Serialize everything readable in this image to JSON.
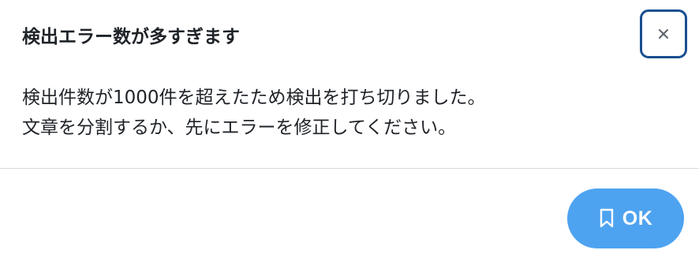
{
  "dialog": {
    "title": "検出エラー数が多すぎます",
    "close_icon": "close-icon",
    "message_lines": [
      "検出件数が1000件を超えたため検出を打ち切りました。",
      "文章を分割するか、先にエラーを修正してください。"
    ],
    "ok_button": {
      "label": "OK",
      "icon": "bookmark-icon"
    }
  },
  "colors": {
    "close_border": "#1a4f91",
    "ok_background": "#4ea3f0",
    "text": "#1f2328",
    "divider": "#d9dbde"
  }
}
